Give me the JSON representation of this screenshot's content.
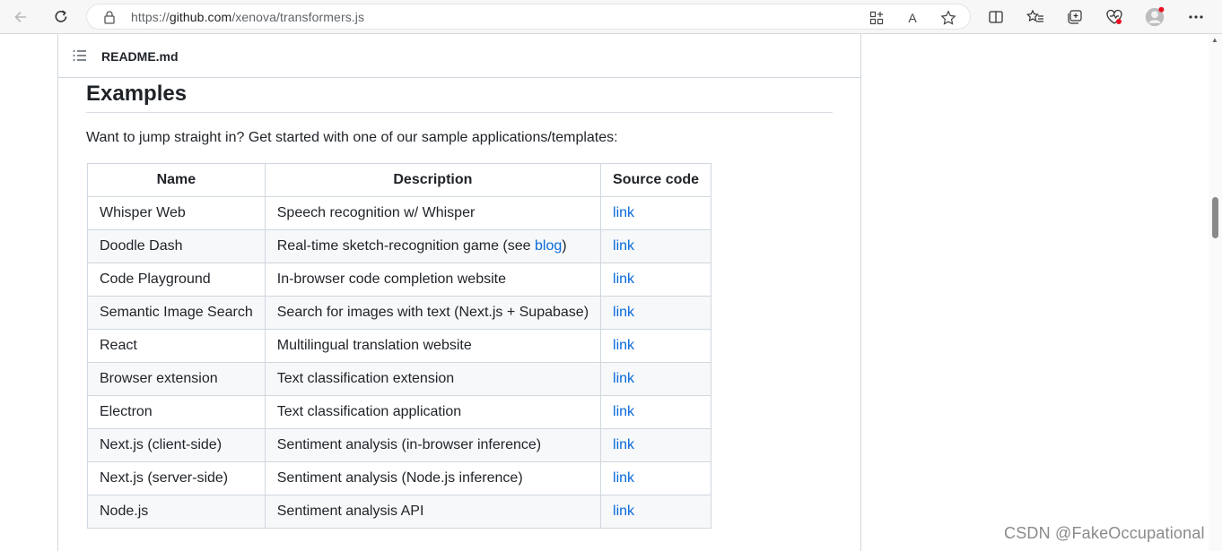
{
  "browser": {
    "url_prefix": "https://",
    "url_host": "github.com",
    "url_path": "/xenova/transformers.js",
    "read_aloud_label": "A"
  },
  "readme": {
    "filename": "README.md"
  },
  "section": {
    "heading": "Examples",
    "intro": "Want to jump straight in? Get started with one of our sample applications/templates:"
  },
  "table": {
    "headers": [
      "Name",
      "Description",
      "Source code"
    ],
    "rows": [
      {
        "name": "Whisper Web",
        "desc": "Speech recognition w/ Whisper",
        "desc_link": "",
        "desc_tail": "",
        "source": "link"
      },
      {
        "name": "Doodle Dash",
        "desc": "Real-time sketch-recognition game (see ",
        "desc_link": "blog",
        "desc_tail": ")",
        "source": "link"
      },
      {
        "name": "Code Playground",
        "desc": "In-browser code completion website",
        "desc_link": "",
        "desc_tail": "",
        "source": "link"
      },
      {
        "name": "Semantic Image Search",
        "desc": "Search for images with text (Next.js + Supabase)",
        "desc_link": "",
        "desc_tail": "",
        "source": "link"
      },
      {
        "name": "React",
        "desc": "Multilingual translation website",
        "desc_link": "",
        "desc_tail": "",
        "source": "link"
      },
      {
        "name": "Browser extension",
        "desc": "Text classification extension",
        "desc_link": "",
        "desc_tail": "",
        "source": "link"
      },
      {
        "name": "Electron",
        "desc": "Text classification application",
        "desc_link": "",
        "desc_tail": "",
        "source": "link"
      },
      {
        "name": "Next.js (client-side)",
        "desc": "Sentiment analysis (in-browser inference)",
        "desc_link": "",
        "desc_tail": "",
        "source": "link"
      },
      {
        "name": "Next.js (server-side)",
        "desc": "Sentiment analysis (Node.js inference)",
        "desc_link": "",
        "desc_tail": "",
        "source": "link"
      },
      {
        "name": "Node.js",
        "desc": "Sentiment analysis API",
        "desc_link": "",
        "desc_tail": "",
        "source": "link"
      }
    ]
  },
  "watermark": "CSDN @FakeOccupational",
  "colors": {
    "link": "#0969da",
    "border": "#d0d7de",
    "alt_row": "#f6f8fa",
    "notification_dot": "#e81123"
  }
}
